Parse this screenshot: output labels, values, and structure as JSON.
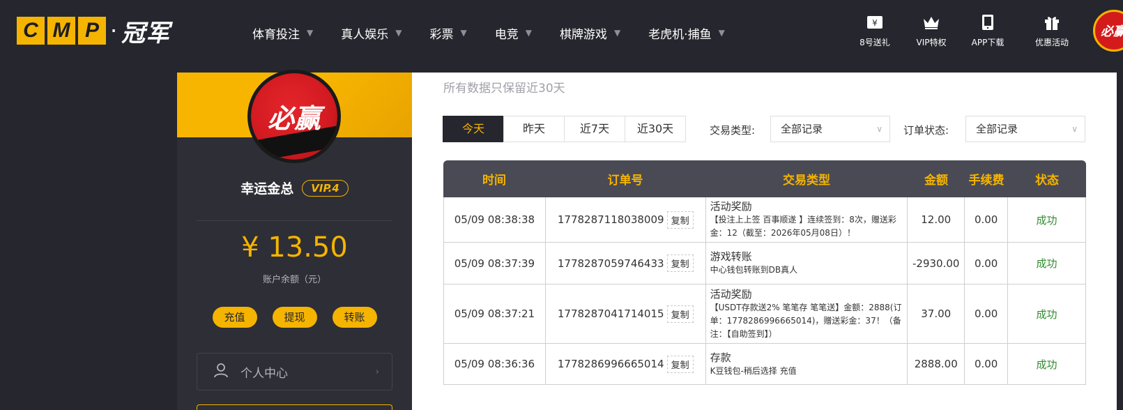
{
  "brand": {
    "logo_letters": [
      "C",
      "M",
      "P"
    ],
    "logo_dot": "·",
    "logo_cn": "冠军"
  },
  "nav": {
    "items": [
      {
        "label": "体育投注"
      },
      {
        "label": "真人娱乐"
      },
      {
        "label": "彩票"
      },
      {
        "label": "电竞"
      },
      {
        "label": "棋牌游戏"
      },
      {
        "label": "老虎机·捕鱼"
      }
    ],
    "quick": [
      {
        "label": "8号送礼",
        "icon": "gift-ticket-icon"
      },
      {
        "label": "VIP特权",
        "icon": "crown-icon"
      },
      {
        "label": "APP下载",
        "icon": "phone-icon"
      },
      {
        "label": "优惠活动",
        "icon": "gift-box-icon"
      }
    ],
    "avatar_text": "必赢"
  },
  "profile": {
    "avatar_text": "必赢",
    "name": "幸运金总",
    "vip": "VIP.4",
    "balance": "¥ 13.50",
    "balance_label": "账户余额（元）",
    "actions": [
      "充值",
      "提现",
      "转账"
    ],
    "center_label": "个人中心"
  },
  "records": {
    "notice": "所有数据只保留近30天",
    "tabs": [
      {
        "label": "今天",
        "active": true
      },
      {
        "label": "昨天",
        "active": false
      },
      {
        "label": "近7天",
        "active": false
      },
      {
        "label": "近30天",
        "active": false
      }
    ],
    "filters": {
      "type_label": "交易类型:",
      "type_value": "全部记录",
      "status_label": "订单状态:",
      "status_value": "全部记录"
    },
    "columns": [
      "时间",
      "订单号",
      "交易类型",
      "金额",
      "手续费",
      "状态"
    ],
    "copy_label": "复制",
    "rows": [
      {
        "time": "05/09 08:38:38",
        "order": "1778287118038009",
        "type_title": "活动奖励",
        "type_desc": "【投注上上签 百事顺遂 】连续签到：8次，赠送彩金：12（截至：2026年05月08日）！",
        "amount": "12.00",
        "fee": "0.00",
        "status": "成功"
      },
      {
        "time": "05/09 08:37:39",
        "order": "1778287059746433",
        "type_title": "游戏转账",
        "type_desc": "中心钱包转账到DB真人",
        "amount": "-2930.00",
        "fee": "0.00",
        "status": "成功"
      },
      {
        "time": "05/09 08:37:21",
        "order": "1778287041714015",
        "type_title": "活动奖励",
        "type_desc": "【USDT存款送2% 笔笔存 笔笔送】金额：2888(订单：1778286996665014)，赠送彩金：37！（备注：【自助签到】）",
        "amount": "37.00",
        "fee": "0.00",
        "status": "成功"
      },
      {
        "time": "05/09 08:36:36",
        "order": "1778286996665014",
        "type_title": "存款",
        "type_desc": "K豆钱包-稍后选择 充值",
        "amount": "2888.00",
        "fee": "0.00",
        "status": "成功"
      }
    ]
  },
  "colors": {
    "accent": "#f5b400",
    "dark": "#26262e",
    "success": "#2e8b2e"
  }
}
